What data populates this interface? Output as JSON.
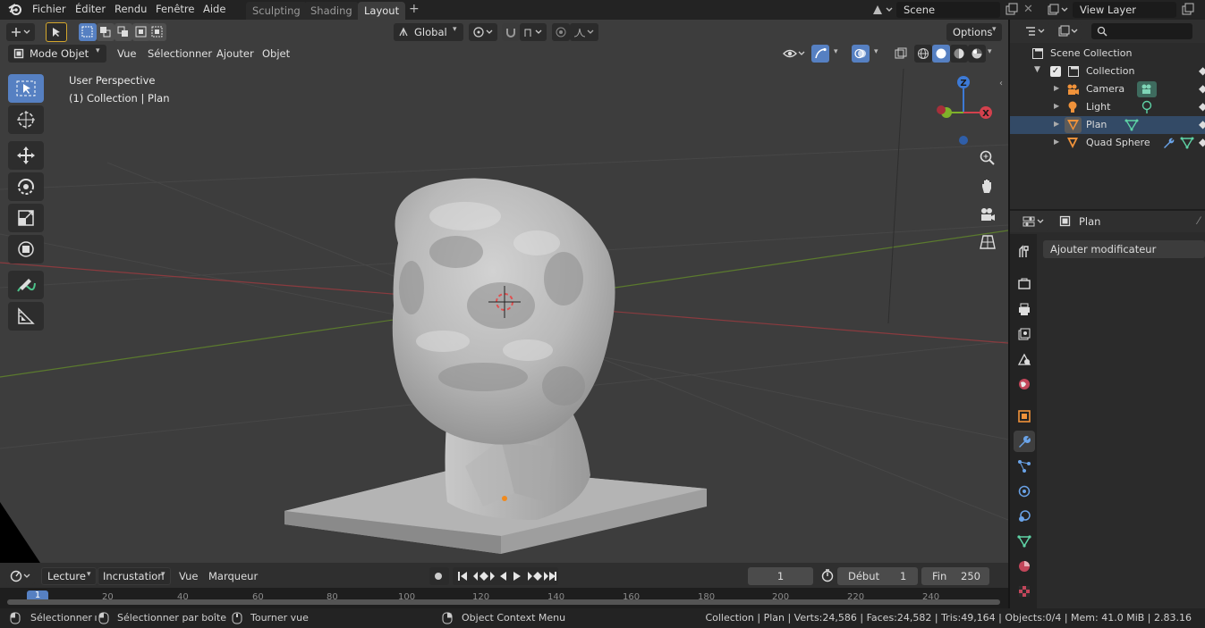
{
  "menu": {
    "items": [
      "Fichier",
      "Éditer",
      "Rendu",
      "Fenêtre",
      "Aide"
    ],
    "workspace_tabs": [
      "Sculpting",
      "Shading",
      "Layout"
    ],
    "active_tab": "Layout",
    "add_tab": "+",
    "scene": "Scene",
    "view_layer": "View Layer"
  },
  "viewport": {
    "mode": "Mode Objet",
    "menus": [
      "Vue",
      "Sélectionner",
      "Ajouter",
      "Objet"
    ],
    "orientation": "Global",
    "options": "Options",
    "info_line1": "User Perspective",
    "info_line2": "(1) Collection | Plan",
    "gizmo": {
      "z": "Z",
      "x": "X"
    }
  },
  "outliner": {
    "root": "Scene Collection",
    "collection": "Collection",
    "items": [
      "Camera",
      "Light",
      "Plan",
      "Quad Sphere"
    ]
  },
  "properties": {
    "object_name": "Plan",
    "add_modifier": "Ajouter modificateur"
  },
  "timeline": {
    "playback": "Lecture",
    "keying": "Incrustation",
    "view": "Vue",
    "markers": "Marqueur",
    "current_frame": "1",
    "start_label": "Début",
    "start_value": "1",
    "end_label": "Fin",
    "end_value": "250",
    "ruler_current": "1",
    "ruler_ticks": [
      "20",
      "40",
      "60",
      "80",
      "100",
      "120",
      "140",
      "160",
      "180",
      "200",
      "220",
      "240"
    ]
  },
  "status": {
    "select": "Sélectionner",
    "box_select": "Sélectionner par boîte",
    "rotate_view": "Tourner vue",
    "context_menu": "Object Context Menu",
    "stats": "Collection | Plan | Verts:24,586 | Faces:24,582 | Tris:49,164 | Objects:0/4 | Mem: 41.0 MiB | 2.83.16"
  },
  "colors": {
    "accent": "#5680c2",
    "axis_x": "#d3414d",
    "axis_y": "#7fb12a",
    "axis_z": "#3d7ad6",
    "viewport_bg": "#3d3d3d",
    "panel_bg": "#2b2b2b"
  }
}
